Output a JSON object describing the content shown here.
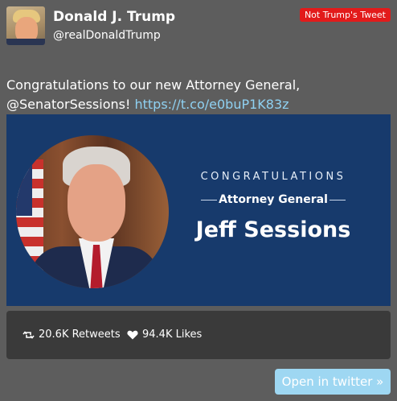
{
  "user": {
    "name": "Donald J. Trump",
    "handle": "@realDonaldTrump"
  },
  "badge": {
    "label": "Not Trump's Tweet",
    "color": "#e21b1b"
  },
  "tweet": {
    "text": "Congratulations to our new Attorney General, @SenatorSessions! ",
    "link": "https://t.co/e0buP1K83z"
  },
  "media": {
    "background_color": "#173a6c",
    "kicker": "CONGRATULATIONS",
    "subtitle": "Attorney General",
    "headline": "Jeff Sessions"
  },
  "stats": {
    "retweets_label": "20.6K Retweets",
    "likes_label": "94.4K Likes",
    "retweet_icon": "retweet-icon",
    "like_icon": "heart-icon"
  },
  "open_button": {
    "label": "Open in twitter »",
    "color": "#9ed7f2"
  }
}
